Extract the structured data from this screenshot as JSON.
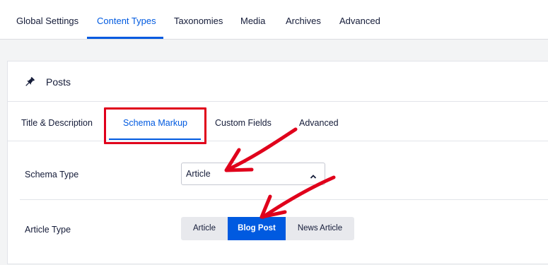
{
  "top_nav": {
    "tabs": [
      {
        "label": "Global Settings"
      },
      {
        "label": "Content Types",
        "active": true
      },
      {
        "label": "Taxonomies"
      },
      {
        "label": "Media"
      },
      {
        "label": "Archives"
      },
      {
        "label": "Advanced"
      }
    ]
  },
  "card": {
    "title": "Posts",
    "icon": "pin-icon",
    "subtabs": [
      {
        "label": "Title & Description"
      },
      {
        "label": "Schema Markup",
        "active": true
      },
      {
        "label": "Custom Fields"
      },
      {
        "label": "Advanced"
      }
    ]
  },
  "form": {
    "schema_type": {
      "label": "Schema Type",
      "value": "Article"
    },
    "article_type": {
      "label": "Article Type",
      "options": [
        {
          "label": "Article"
        },
        {
          "label": "Blog Post",
          "selected": true
        },
        {
          "label": "News Article"
        }
      ]
    }
  },
  "colors": {
    "accent": "#005ae0",
    "annotation": "#e0001b",
    "text": "#141b38"
  }
}
